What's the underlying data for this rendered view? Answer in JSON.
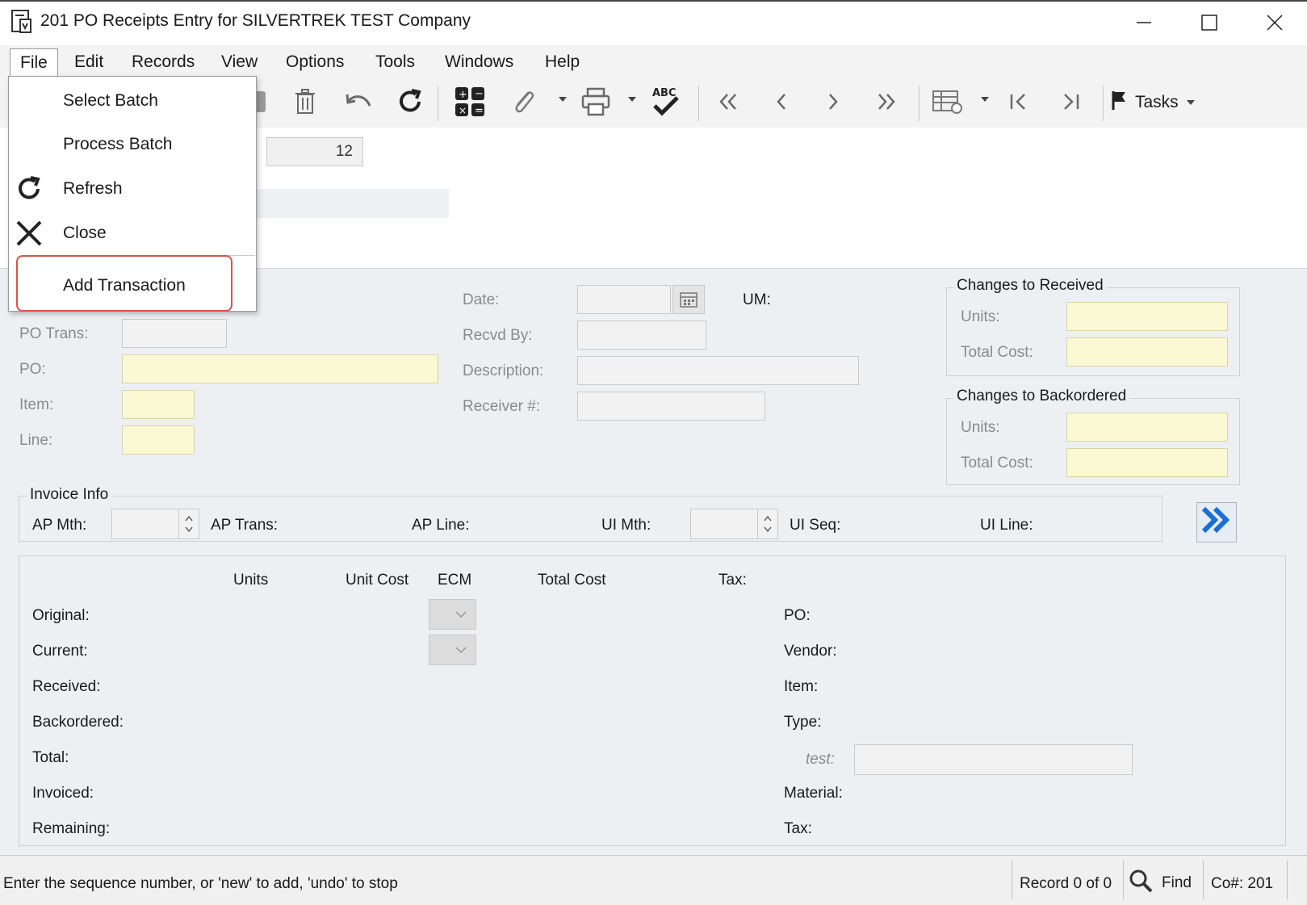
{
  "window": {
    "title": "201 PO Receipts Entry for SILVERTREK TEST Company",
    "icon": "document-app-icon",
    "controls": [
      "minimize-icon",
      "maximize-icon",
      "close-icon"
    ]
  },
  "menubar": {
    "items": [
      {
        "label": "File",
        "open": true
      },
      {
        "label": "Edit"
      },
      {
        "label": "Records"
      },
      {
        "label": "View"
      },
      {
        "label": "Options"
      },
      {
        "label": "Tools"
      },
      {
        "label": "Windows"
      },
      {
        "label": "Help"
      }
    ]
  },
  "file_menu": {
    "items": [
      {
        "label": "Select Batch",
        "icon": ""
      },
      {
        "label": "Process Batch",
        "icon": ""
      },
      {
        "label": "Refresh",
        "icon": "refresh-icon"
      },
      {
        "label": "Close",
        "icon": "close-x-icon"
      },
      {
        "label": "Add Transaction",
        "icon": "",
        "highlighted": true
      }
    ]
  },
  "toolbar": {
    "tasks_label": "Tasks",
    "icons": [
      "save-icon",
      "delete-icon",
      "undo-icon",
      "refresh-icon",
      "calculator-icon",
      "attachment-icon",
      "print-icon",
      "spellcheck-icon",
      "first-record-icon",
      "previous-record-icon",
      "next-record-icon",
      "last-record-icon",
      "grid-settings-icon",
      "first-line-icon",
      "last-line-icon",
      "flag-icon"
    ],
    "spellcheck_text": "ABC"
  },
  "header": {
    "seq_value": "12"
  },
  "form": {
    "labels": {
      "po_trans": "PO Trans:",
      "po": "PO:",
      "item": "Item:",
      "line": "Line:",
      "date": "Date:",
      "recvd_by": "Recvd By:",
      "description": "Description:",
      "receiver": "Receiver #:",
      "um": "UM:"
    }
  },
  "changes_received": {
    "title": "Changes to Received",
    "units": "Units:",
    "total_cost": "Total Cost:"
  },
  "changes_backordered": {
    "title": "Changes to Backordered",
    "units": "Units:",
    "total_cost": "Total Cost:"
  },
  "invoice_info": {
    "title": "Invoice Info",
    "ap_mth": "AP Mth:",
    "ap_trans": "AP Trans:",
    "ap_line": "AP Line:",
    "ui_mth": "UI Mth:",
    "ui_seq": "UI Seq:",
    "ui_line": "UI Line:"
  },
  "totals": {
    "columns": [
      "Units",
      "Unit Cost",
      "ECM",
      "Total Cost",
      "Tax:"
    ],
    "rows": [
      "Original:",
      "Current:",
      "Received:",
      "Backordered:",
      "Total:",
      "Invoiced:",
      "Remaining:"
    ],
    "right_labels": [
      "PO:",
      "Vendor:",
      "Item:",
      "Type:"
    ],
    "test_label": "test:",
    "material": "Material:",
    "tax": "Tax:"
  },
  "statusbar": {
    "message": "Enter the sequence number, or 'new' to add, 'undo' to stop",
    "record": "Record 0 of 0",
    "find": "Find",
    "company": "Co#: 201"
  },
  "colors": {
    "highlight_border": "#d9534f",
    "required_field": "#fbf8d4",
    "panel_bg": "#edf0f3",
    "nav_arrow_blue": "#1a6fd6"
  }
}
